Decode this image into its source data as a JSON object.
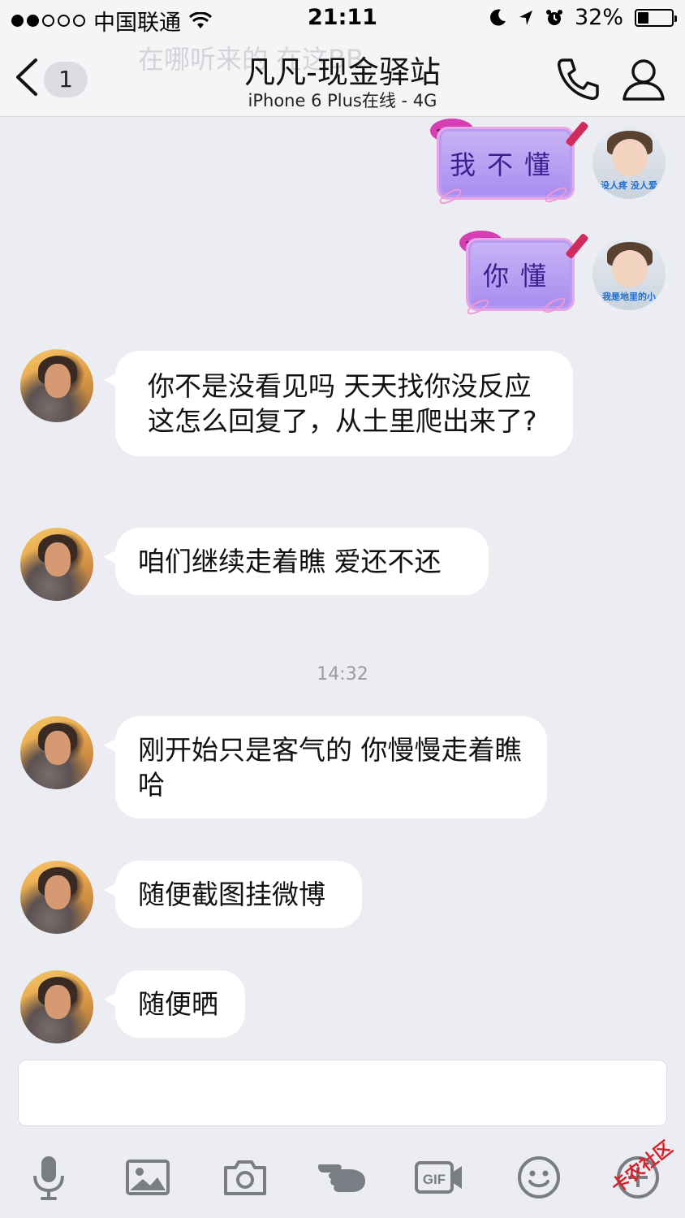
{
  "status_bar": {
    "carrier": "中国联通",
    "time": "21:11",
    "battery_percent": "32%",
    "battery_level": 0.32
  },
  "nav": {
    "ghost_preview": "在哪听来的 在这BB",
    "unread_count": "1",
    "title": "凡凡-现金驿站",
    "subtitle": "iPhone 6 Plus在线 - 4G"
  },
  "messages": {
    "sticker_1": "我不懂",
    "sticker_2": "你懂",
    "self_avatar_caption_1": "没人疼 没人爱",
    "self_avatar_caption_2": "我是地里的小",
    "msg_1": "你不是没看见吗 天天找你没反应 这怎么回复了，从土里爬出来了?",
    "msg_2": "咱们继续走着瞧 爱还不还",
    "timestamp": "14:32",
    "msg_3": "刚开始只是客气的 你慢慢走着瞧哈",
    "msg_4": "随便截图挂微博",
    "msg_5": "随便晒"
  },
  "input": {
    "placeholder": ""
  },
  "toolbar": {
    "icons": [
      "microphone-icon",
      "image-icon",
      "camera-icon",
      "poke-icon",
      "gif-icon",
      "emoji-icon",
      "plus-icon"
    ],
    "gif_label": "GIF"
  },
  "watermark": "卡农社区"
}
